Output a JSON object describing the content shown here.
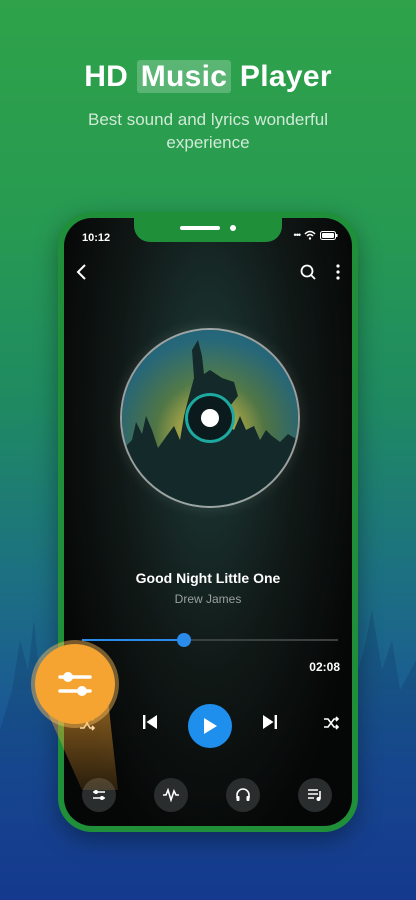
{
  "promo": {
    "headline_pre": "HD ",
    "headline_highlight": "Music",
    "headline_post": " Player",
    "subtitle": "Best sound and lyrics wonderful experience"
  },
  "status_bar": {
    "time": "10:12"
  },
  "player": {
    "song_title": "Good Night Little One",
    "artist": "Drew James",
    "duration": "02:08",
    "progress": 0.4
  },
  "colors": {
    "accent_blue": "#1f8fee",
    "phone_frame": "#1f8f3a",
    "eq_bubble": "#f6a431"
  },
  "icons": {
    "top": [
      "back-icon",
      "search-icon",
      "more-icon"
    ],
    "controls": [
      "shuffle-icon",
      "previous-icon",
      "play-icon",
      "next-icon",
      "repeat-shuffle-icon"
    ],
    "bottom": [
      "equalizer-icon",
      "sound-effect-icon",
      "headphones-icon",
      "playlist-icon"
    ]
  }
}
